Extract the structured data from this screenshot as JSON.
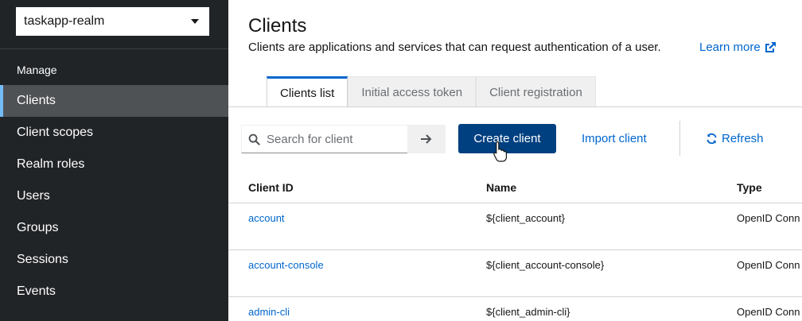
{
  "sidebar": {
    "realm": "taskapp-realm",
    "section": "Manage",
    "items": [
      {
        "label": "Clients"
      },
      {
        "label": "Client scopes"
      },
      {
        "label": "Realm roles"
      },
      {
        "label": "Users"
      },
      {
        "label": "Groups"
      },
      {
        "label": "Sessions"
      },
      {
        "label": "Events"
      }
    ],
    "active_item": "Clients"
  },
  "header": {
    "title": "Clients",
    "description": "Clients are applications and services that can request authentication of a user.",
    "learn_more": "Learn more"
  },
  "tabs": [
    {
      "label": "Clients list"
    },
    {
      "label": "Initial access token"
    },
    {
      "label": "Client registration"
    }
  ],
  "toolbar": {
    "search_placeholder": "Search for client",
    "create_label": "Create client",
    "import_label": "Import client",
    "refresh_label": "Refresh"
  },
  "table": {
    "columns": [
      "Client ID",
      "Name",
      "Type"
    ],
    "rows": [
      {
        "client_id": "account",
        "name": "${client_account}",
        "type": "OpenID Conn"
      },
      {
        "client_id": "account-console",
        "name": "${client_account-console}",
        "type": "OpenID Conn"
      },
      {
        "client_id": "admin-cli",
        "name": "${client_admin-cli}",
        "type": "OpenID Conn"
      }
    ]
  },
  "colors": {
    "sidebar_bg": "#212427",
    "active_bg": "#4f5255",
    "accent_blue": "#0066cc",
    "primary_button": "#004080"
  },
  "icons": [
    "chevron-down-icon",
    "external-link-icon",
    "search-icon",
    "arrow-right-icon",
    "sync-icon",
    "hand-pointer-icon"
  ]
}
